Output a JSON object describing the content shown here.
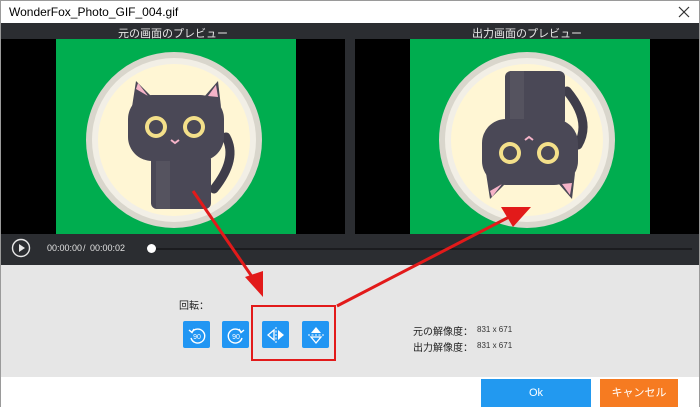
{
  "window": {
    "title": "WonderFox_Photo_GIF_004.gif"
  },
  "preview": {
    "original_label": "元の画面のプレビュー",
    "output_label": "出力画面のプレビュー"
  },
  "playback": {
    "current_time": "00:00:00",
    "separator": "/",
    "total_time": "00:00:02",
    "progress": 0.0
  },
  "rotation": {
    "label": "回転：",
    "tools": [
      {
        "name": "rotate-ccw-90",
        "text": "90"
      },
      {
        "name": "rotate-cw-90",
        "text": "90"
      },
      {
        "name": "flip-horizontal",
        "text": ""
      },
      {
        "name": "flip-vertical",
        "text": ""
      }
    ]
  },
  "resolution": {
    "original_label": "元の解像度：",
    "original_value": "831 x 671",
    "output_label": "出力解像度：",
    "output_value": "831 x 671"
  },
  "buttons": {
    "ok": "Ok",
    "cancel": "キャンセル"
  },
  "colors": {
    "accent": "#2196f3",
    "cancel": "#f67b21",
    "highlight": "#e21a1a",
    "green_screen": "#00ad4f"
  }
}
